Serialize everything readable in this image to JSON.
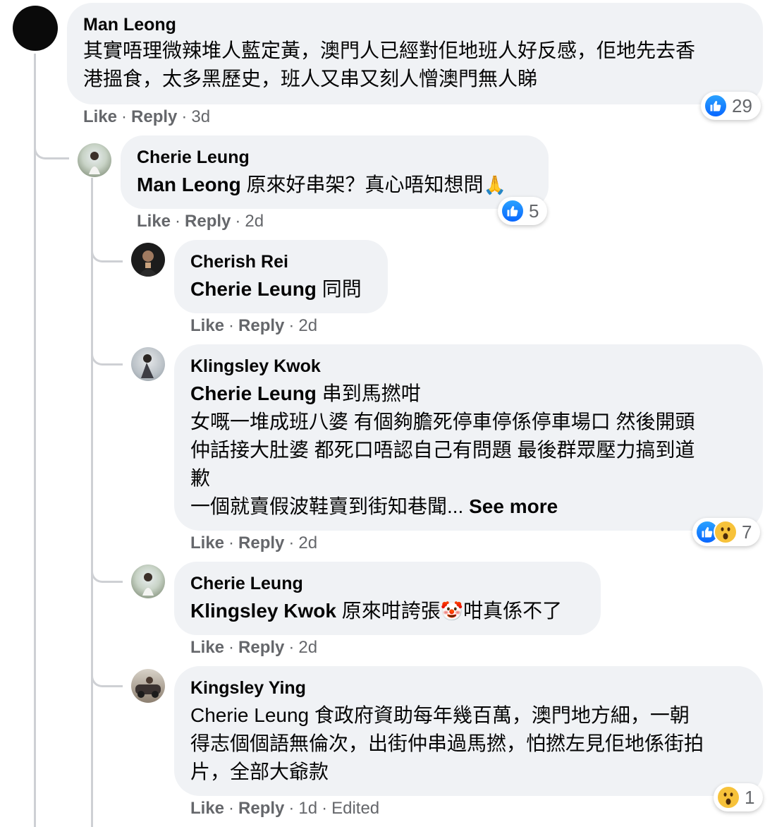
{
  "actions": {
    "like": "Like",
    "reply": "Reply"
  },
  "comments": [
    {
      "author": "Man Leong",
      "line1": "其實唔理微辣堆人藍定黃，澳門人已經對佢地班人好反感，佢地先去香",
      "line2": "港搵食，太多黑歷史，班人又串又刻人憎澳門無人睇",
      "time": "3d",
      "reactions": "29"
    },
    {
      "author": "Cherie Leung",
      "mention": "Man Leong",
      "text": " 原來好串架？真心唔知想問",
      "time": "2d",
      "reactions": "5"
    },
    {
      "author": "Cherish Rei",
      "mention": "Cherie Leung",
      "text": " 同問",
      "time": "2d"
    },
    {
      "author": "Klingsley Kwok",
      "mention": "Cherie Leung",
      "text": " 串到馬撚咁",
      "line2": "女嘅一堆成班八婆 有個夠膽死停車停係停車場口 然後開頭",
      "line3": "仲話接大肚婆 都死口唔認自己有問題 最後群眾壓力搞到道",
      "line4": "歉",
      "line5": "一個就賣假波鞋賣到街知巷聞...",
      "see_more": "See more",
      "time": "2d",
      "reactions": "7"
    },
    {
      "author": "Cherie Leung",
      "mention": "Klingsley Kwok",
      "text": " 原來咁誇張",
      "text_after": "咁真係不了",
      "time": "2d"
    },
    {
      "author": "Kingsley Ying",
      "mention": "Cherie Leung",
      "text": " 食政府資助每年幾百萬，澳門地方細，一朝",
      "line2": "得志個個語無倫次，出街仲串過馬撚，怕撚左見佢地係街拍",
      "line3": "片，全部大爺款",
      "time": "1d",
      "edited": "Edited",
      "reactions": "1"
    }
  ],
  "icons": {
    "like_color": "#0866ff",
    "wow_color": "#f7c23a",
    "pray": "🙏",
    "clown": "🤡"
  }
}
